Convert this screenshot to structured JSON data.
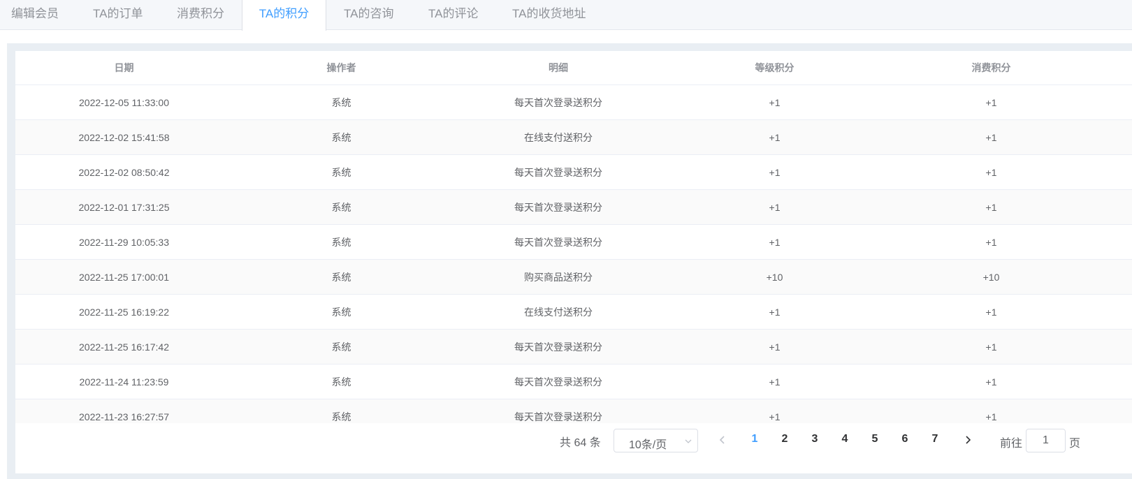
{
  "tabs": [
    {
      "label": "编辑会员"
    },
    {
      "label": "TA的订单"
    },
    {
      "label": "消费积分"
    },
    {
      "label": "TA的积分"
    },
    {
      "label": "TA的咨询"
    },
    {
      "label": "TA的评论"
    },
    {
      "label": "TA的收货地址"
    }
  ],
  "active_tab_index": 3,
  "table": {
    "headers": {
      "date": "日期",
      "operator": "操作者",
      "detail": "明细",
      "level_points": "等级积分",
      "consume_points": "消费积分"
    },
    "rows": [
      {
        "date": "2022-12-05 11:33:00",
        "operator": "系统",
        "detail": "每天首次登录送积分",
        "level_points": "+1",
        "consume_points": "+1"
      },
      {
        "date": "2022-12-02 15:41:58",
        "operator": "系统",
        "detail": "在线支付送积分",
        "level_points": "+1",
        "consume_points": "+1"
      },
      {
        "date": "2022-12-02 08:50:42",
        "operator": "系统",
        "detail": "每天首次登录送积分",
        "level_points": "+1",
        "consume_points": "+1"
      },
      {
        "date": "2022-12-01 17:31:25",
        "operator": "系统",
        "detail": "每天首次登录送积分",
        "level_points": "+1",
        "consume_points": "+1"
      },
      {
        "date": "2022-11-29 10:05:33",
        "operator": "系统",
        "detail": "每天首次登录送积分",
        "level_points": "+1",
        "consume_points": "+1"
      },
      {
        "date": "2022-11-25 17:00:01",
        "operator": "系统",
        "detail": "购买商品送积分",
        "level_points": "+10",
        "consume_points": "+10"
      },
      {
        "date": "2022-11-25 16:19:22",
        "operator": "系统",
        "detail": "在线支付送积分",
        "level_points": "+1",
        "consume_points": "+1"
      },
      {
        "date": "2022-11-25 16:17:42",
        "operator": "系统",
        "detail": "每天首次登录送积分",
        "level_points": "+1",
        "consume_points": "+1"
      },
      {
        "date": "2022-11-24 11:23:59",
        "operator": "系统",
        "detail": "每天首次登录送积分",
        "level_points": "+1",
        "consume_points": "+1"
      },
      {
        "date": "2022-11-23 16:27:57",
        "operator": "系统",
        "detail": "每天首次登录送积分",
        "level_points": "+1",
        "consume_points": "+1"
      }
    ]
  },
  "pagination": {
    "total_text": "共 64 条",
    "page_size_label": "10条/页",
    "pages": [
      "1",
      "2",
      "3",
      "4",
      "5",
      "6",
      "7"
    ],
    "current_page": "1",
    "goto_prefix": "前往",
    "goto_value": "1",
    "goto_suffix": "页",
    "prev_icon": "chevron-left-icon",
    "next_icon": "chevron-right-icon"
  },
  "colors": {
    "accent": "#409eff",
    "panel_bg": "#e9eef3",
    "tabs_bg": "#f5f7fa"
  }
}
